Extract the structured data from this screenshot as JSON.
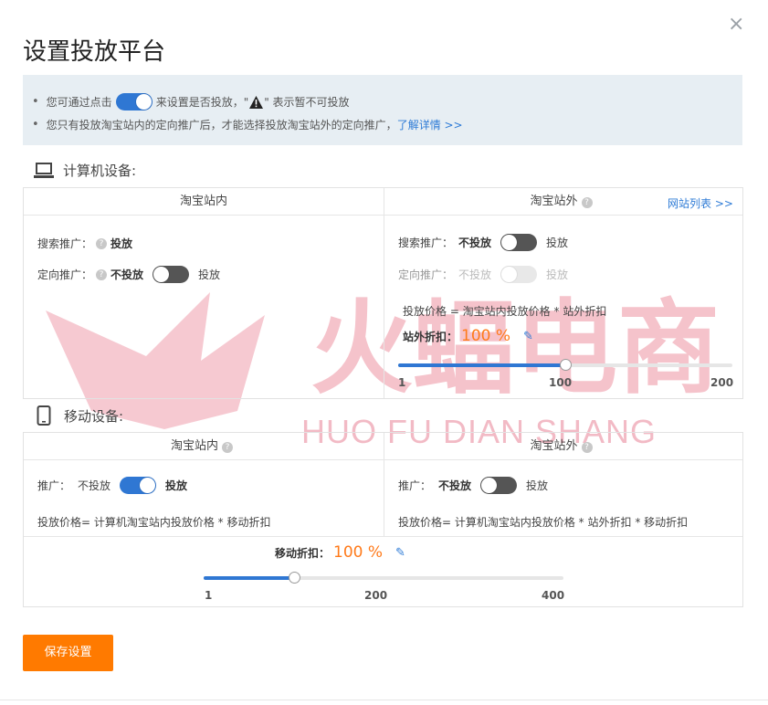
{
  "dialog": {
    "title": "设置投放平台",
    "close_glyph": "×"
  },
  "notice": {
    "line1_prefix": "您可通过点击",
    "line1_mid": "来设置是否投放，\"",
    "line1_suffix": "\" 表示暂不可投放",
    "line2_text": "您只有投放淘宝站内的定向推广后，才能选择投放淘宝站外的定向推广，",
    "line2_link": "了解详情 >>"
  },
  "pc": {
    "heading": "计算机设备:",
    "inner_head": "淘宝站内",
    "outer_head": "淘宝站外",
    "site_list_link": "网站列表 >>",
    "inner": {
      "search_label": "搜索推广：",
      "search_value": "投放",
      "target_label": "定向推广：",
      "target_off": "不投放",
      "target_on": "投放"
    },
    "outer": {
      "search_label": "搜索推广：",
      "search_off": "不投放",
      "search_on": "投放",
      "target_label": "定向推广：",
      "target_off": "不投放",
      "target_on": "投放",
      "price_formula": "投放价格 = 淘宝站内投放价格 * 站外折扣",
      "discount_label": "站外折扣：",
      "discount_value": "100 %",
      "slider": {
        "min": "1",
        "mid": "100",
        "max": "200",
        "value_fraction": 0.5
      }
    }
  },
  "mobile": {
    "heading": "移动设备:",
    "inner_head": "淘宝站内",
    "outer_head": "淘宝站外",
    "inner": {
      "promo_label": "推广：",
      "promo_off": "不投放",
      "promo_on": "投放",
      "price_formula": "投放价格= 计算机淘宝站内投放价格 * 移动折扣"
    },
    "outer": {
      "promo_label": "推广：",
      "promo_off": "不投放",
      "promo_on": "投放",
      "price_formula": "投放价格= 计算机淘宝站内投放价格 * 站外折扣 * 移动折扣"
    },
    "discount_label": "移动折扣：",
    "discount_value": "100 %",
    "slider": {
      "min": "1",
      "mid": "200",
      "max": "400",
      "value_fraction": 0.25
    }
  },
  "save_button": "保存设置",
  "watermark": {
    "cn": "火蝠电商",
    "en": "HUO FU DIAN SHANG"
  },
  "colors": {
    "accent": "#2f77d3",
    "orange": "#ff7a1a",
    "button": "#ff7a00",
    "notice_bg": "#e7eef3",
    "watermark": "#f2b8c2"
  },
  "icons": [
    "close-icon",
    "toggle-icon",
    "warning-icon",
    "laptop-icon",
    "phone-icon",
    "help-icon",
    "pencil-icon"
  ]
}
